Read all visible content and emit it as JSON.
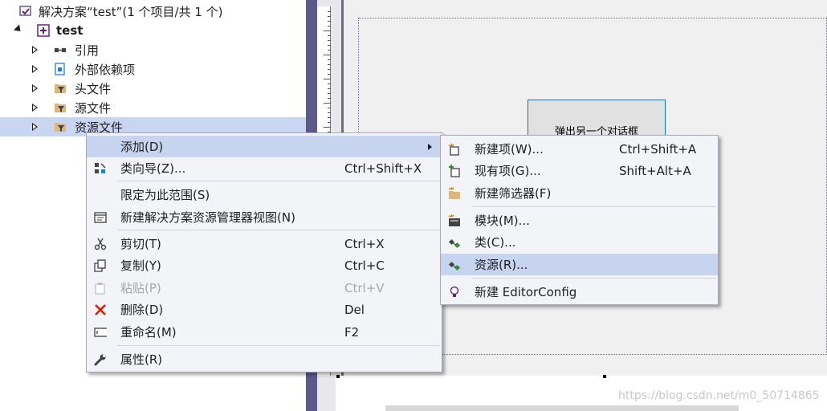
{
  "solution_explorer": {
    "solution_label": "解决方案“test”(1 个项目/共 1 个)",
    "project_label": "test",
    "nodes": [
      {
        "label": "引用",
        "icon": "references-icon"
      },
      {
        "label": "外部依赖项",
        "icon": "external-dependencies-icon"
      },
      {
        "label": "头文件",
        "icon": "folder-filter-icon"
      },
      {
        "label": "源文件",
        "icon": "folder-filter-icon"
      },
      {
        "label": "资源文件",
        "icon": "folder-filter-icon"
      }
    ],
    "selected": "资源文件"
  },
  "designer": {
    "button_text": "弹出另一个对话框"
  },
  "context_menu": {
    "items": [
      {
        "label": "添加(D)",
        "shortcut": "",
        "icon": "",
        "submenu": true,
        "highlighted": true
      },
      {
        "label": "类向导(Z)...",
        "shortcut": "Ctrl+Shift+X",
        "icon": "class-wizard-icon"
      },
      {
        "label": "限定为此范围(S)",
        "shortcut": "",
        "icon": ""
      },
      {
        "label": "新建解决方案资源管理器视图(N)",
        "shortcut": "",
        "icon": "new-view-icon"
      },
      {
        "label": "剪切(T)",
        "shortcut": "Ctrl+X",
        "icon": "scissors-icon"
      },
      {
        "label": "复制(Y)",
        "shortcut": "Ctrl+C",
        "icon": "copy-icon"
      },
      {
        "label": "粘贴(P)",
        "shortcut": "Ctrl+V",
        "icon": "paste-icon",
        "disabled": true
      },
      {
        "label": "删除(D)",
        "shortcut": "Del",
        "icon": "delete-icon"
      },
      {
        "label": "重命名(M)",
        "shortcut": "F2",
        "icon": "rename-icon"
      },
      {
        "label": "属性(R)",
        "shortcut": "",
        "icon": "wrench-icon"
      }
    ]
  },
  "submenu": {
    "items": [
      {
        "label": "新建项(W)...",
        "shortcut": "Ctrl+Shift+A",
        "icon": "new-item-icon"
      },
      {
        "label": "现有项(G)...",
        "shortcut": "Shift+Alt+A",
        "icon": "existing-item-icon"
      },
      {
        "label": "新建筛选器(F)",
        "shortcut": "",
        "icon": "new-filter-icon"
      },
      {
        "label": "模块(M)...",
        "shortcut": "",
        "icon": "module-icon"
      },
      {
        "label": "类(C)...",
        "shortcut": "",
        "icon": "class-icon"
      },
      {
        "label": "资源(R)...",
        "shortcut": "",
        "icon": "resource-icon",
        "highlighted": true
      },
      {
        "label": "新建 EditorConfig",
        "shortcut": "",
        "icon": "lightbulb-icon"
      }
    ]
  },
  "watermark": "https://blog.csdn.net/m0_50714865",
  "colors": {
    "selection": "#c9d6f1",
    "menu_highlight": "#c6d4f0",
    "menu_bg": "#f2f4f8",
    "splitter": "#5d5a8a",
    "delete_red": "#e51400"
  }
}
